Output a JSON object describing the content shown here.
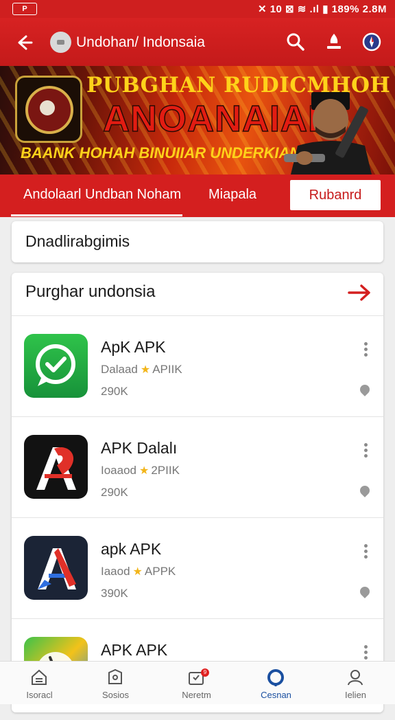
{
  "status_bar": {
    "left": "P",
    "right": "✕ 10 ⊠ ≋ .ıl ▮ 189% 2.8M"
  },
  "app_bar": {
    "title": "Undohan/ Indonsaia"
  },
  "banner": {
    "headline": "PUBGHAN RUDICMHOH",
    "main_text": "ANOANAIAI",
    "subtext": "BAANK HOHAH BINUIIAR UNDERKIAN!"
  },
  "tabs": {
    "tab1": "Andolaarl Undban  Noham",
    "tab2": "Miapala",
    "button": "Rubanrd"
  },
  "search": {
    "text": "Dnadlirabgimis"
  },
  "list": {
    "title": "Purghar undonsia",
    "items": [
      {
        "name": "ApK APK",
        "meta_prefix": "Dalaad",
        "meta_suffix": "APIIK",
        "size": "290K"
      },
      {
        "name": "APK Dalalı",
        "meta_prefix": "Ioaaod",
        "meta_suffix": "2PIIK",
        "size": "290K"
      },
      {
        "name": "apk APK",
        "meta_prefix": "Iaaod",
        "meta_suffix": "APPK",
        "size": "390K"
      },
      {
        "name": "APK APK",
        "meta_prefix": "",
        "meta_suffix": "",
        "size": ""
      }
    ]
  },
  "bottom_nav": {
    "items": [
      {
        "label": "Isoracl"
      },
      {
        "label": "Sosios"
      },
      {
        "label": "Neretm",
        "badge": "9"
      },
      {
        "label": "Cesnan"
      },
      {
        "label": "Ielien"
      }
    ]
  },
  "colors": {
    "primary": "#d41f1f",
    "accent_star": "#f2b51a",
    "nav_active": "#1a4fa0"
  }
}
